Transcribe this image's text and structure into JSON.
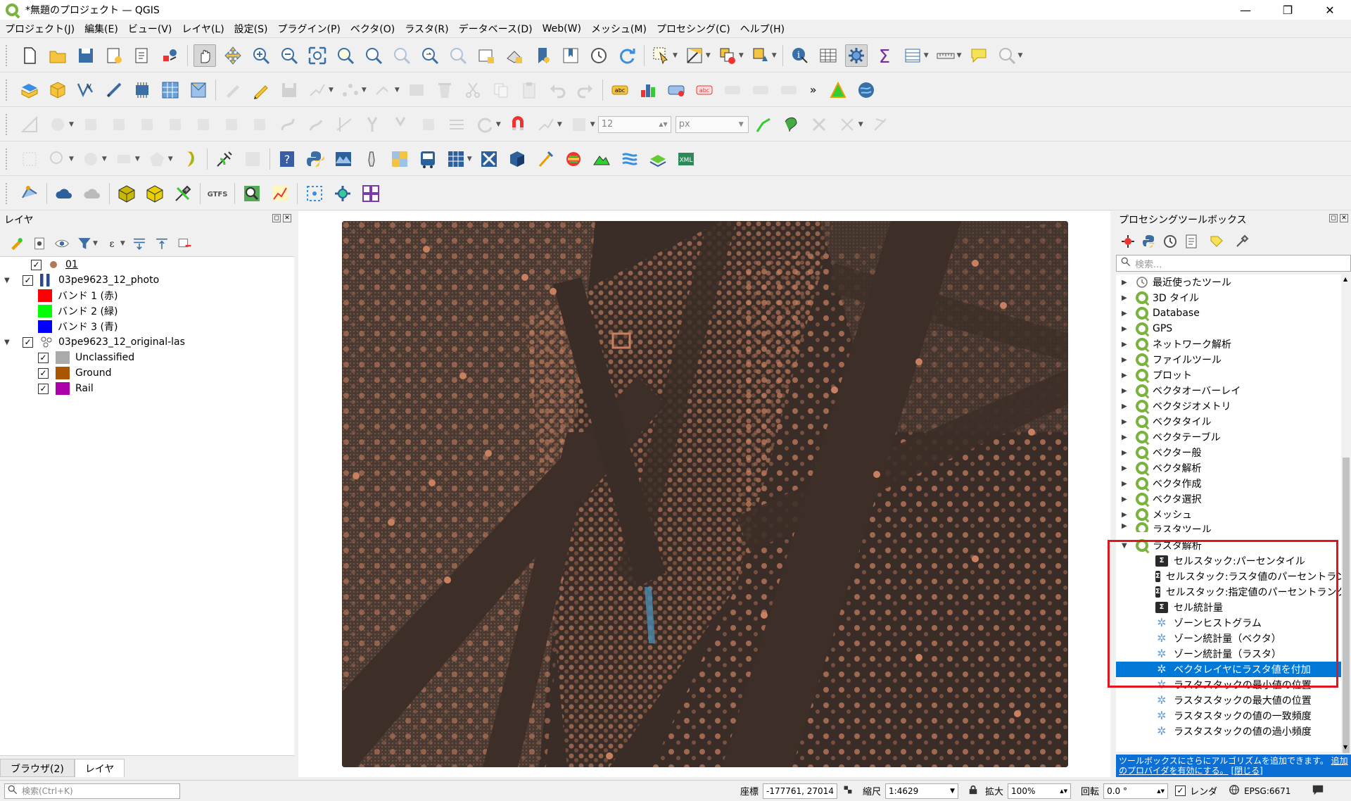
{
  "window": {
    "title": "*無題のプロジェクト — QGIS"
  },
  "menu": [
    "プロジェクト(J)",
    "編集(E)",
    "ビュー(V)",
    "レイヤ(L)",
    "設定(S)",
    "プラグイン(P)",
    "ベクタ(O)",
    "ラスタ(R)",
    "データベース(D)",
    "Web(W)",
    "メッシュ(M)",
    "プロセシング(C)",
    "ヘルプ(H)"
  ],
  "snapping": {
    "tolerance": "12",
    "unit": "px"
  },
  "layers_panel": {
    "title": "レイヤ",
    "items": [
      {
        "label": "01"
      },
      {
        "label": "03pe9623_12_photo"
      },
      {
        "label": "バンド 1 (赤)",
        "color": "#ff0000"
      },
      {
        "label": "バンド 2 (緑)",
        "color": "#00ff00"
      },
      {
        "label": "バンド 3 (青)",
        "color": "#0000ff"
      },
      {
        "label": "03pe9623_12_original-las"
      },
      {
        "label": "Unclassified",
        "color": "#aaaaaa"
      },
      {
        "label": "Ground",
        "color": "#aa5500"
      },
      {
        "label": "Rail",
        "color": "#aa00aa"
      }
    ]
  },
  "tabs": [
    "ブラウザ(2)",
    "レイヤ"
  ],
  "processing": {
    "title": "プロセシングツールボックス",
    "search_placeholder": "検索...",
    "groups": [
      "最近使ったツール",
      "3D タイル",
      "Database",
      "GPS",
      "ネットワーク解析",
      "ファイルツール",
      "プロット",
      "ベクタオーバーレイ",
      "ベクタジオメトリ",
      "ベクタタイル",
      "ベクタテーブル",
      "ベクター般",
      "ベクタ解析",
      "ベクタ作成",
      "ベクタ選択",
      "メッシュ",
      "ラスタツール"
    ],
    "expanded_group": "ラスタ解析",
    "algorithms": [
      "セルスタック:パーセンタイル",
      "セルスタック:ラスタ値のパーセントランク",
      "セルスタック:指定値のパーセントランク",
      "セル統計量",
      "ゾーンヒストグラム",
      "ゾーン統計量（ベクタ）",
      "ゾーン統計量（ラスタ）",
      "ベクタレイヤにラスタ値を付加",
      "ラスタスタックの最小値の位置",
      "ラスタスタックの最大値の位置",
      "ラスタスタックの値の一致頻度",
      "ラスタスタックの値の過小頻度"
    ],
    "selected_algorithm": "ベクタレイヤにラスタ値を付加",
    "info_text": "ツールボックスにさらにアルゴリズムを追加できます。",
    "info_link1": "追加のプロバイダを有効にする。",
    "info_link2": "[閉じる]"
  },
  "status": {
    "search_placeholder": "検索(Ctrl+K)",
    "coord_label": "座標",
    "coord_value": "-177761, 27014",
    "scale_label": "縮尺",
    "scale_value": "1:4629",
    "magnify_label": "拡大",
    "magnify_value": "100%",
    "rotation_label": "回転",
    "rotation_value": "0.0 °",
    "render_label": "レンダ",
    "crs": "EPSG:6671"
  },
  "colors": {
    "accent": "#0078d7",
    "highlight_box": "#e0161c",
    "qgis_green": "#79b33e",
    "map_bg": "#3e302a",
    "point_color": "#c98060"
  }
}
